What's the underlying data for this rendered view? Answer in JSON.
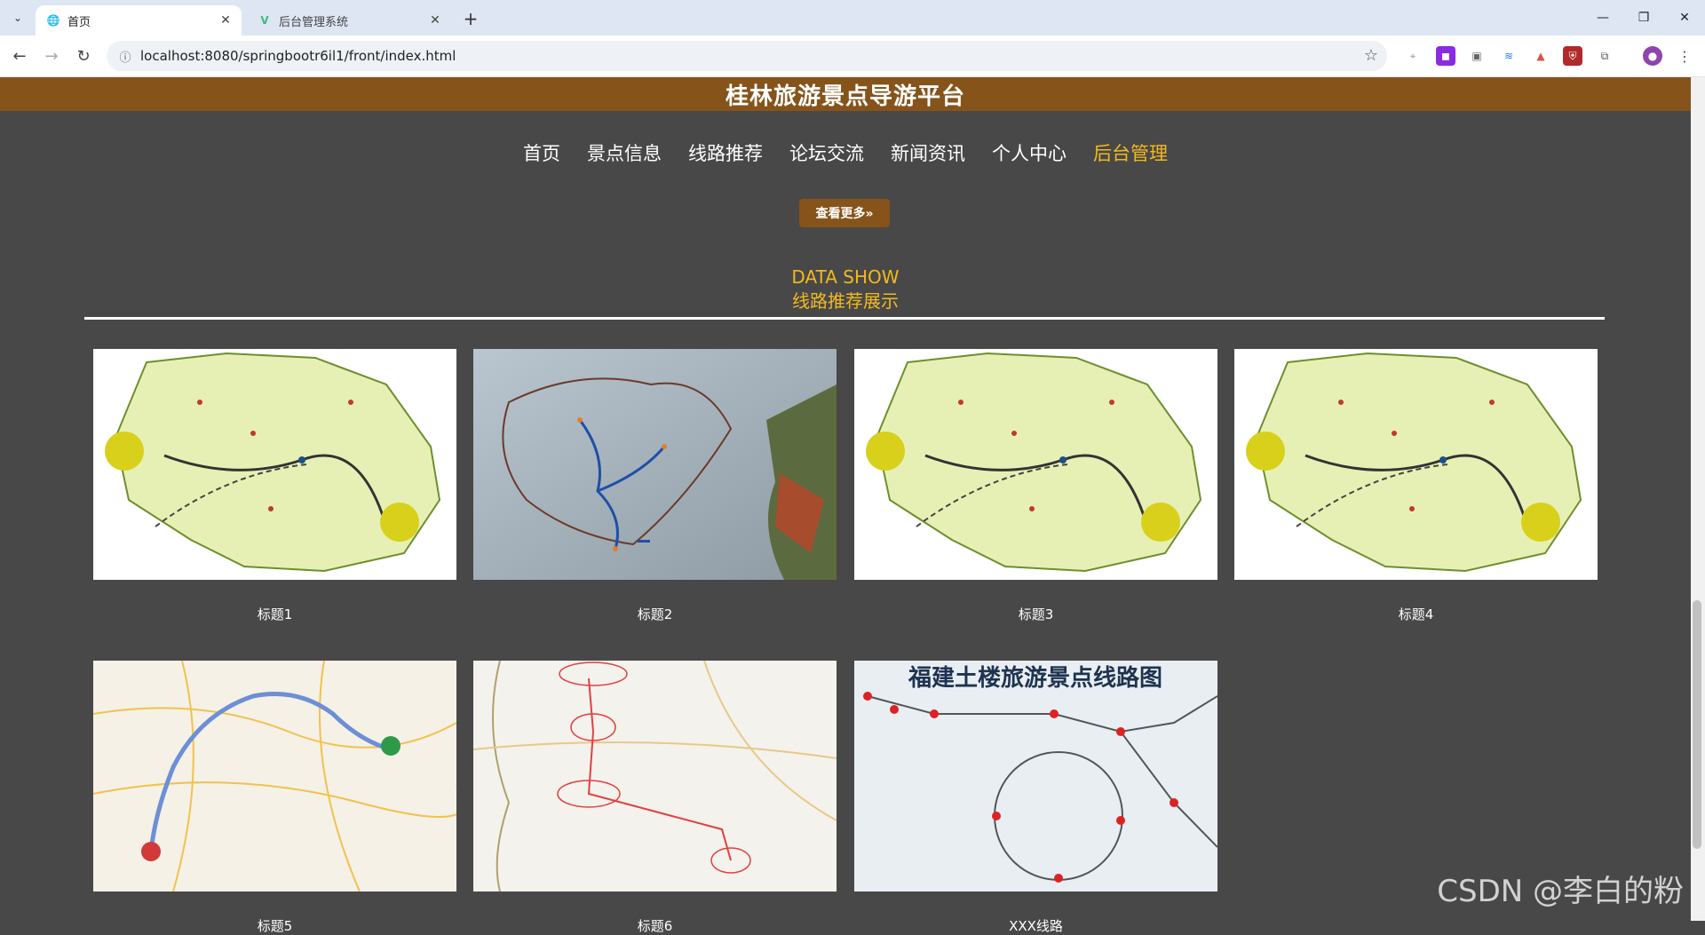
{
  "browser": {
    "tabs": [
      {
        "label": "首页",
        "active": true
      },
      {
        "label": "后台管理系统",
        "active": false
      }
    ],
    "url": "localhost:8080/springbootr6il1/front/index.html",
    "window_controls": {
      "minimize": "—",
      "restore": "❐",
      "close": "✕"
    }
  },
  "site": {
    "title": "桂林旅游景点导游平台",
    "brand_color": "#86531b",
    "accent_color": "#f2b91e"
  },
  "nav": {
    "items": [
      {
        "label": "首页"
      },
      {
        "label": "景点信息"
      },
      {
        "label": "线路推荐"
      },
      {
        "label": "论坛交流"
      },
      {
        "label": "新闻资讯"
      },
      {
        "label": "个人中心"
      },
      {
        "label": "后台管理"
      }
    ],
    "active_index": 6
  },
  "more_button": {
    "label": "查看更多»"
  },
  "section": {
    "title_en": "DATA SHOW",
    "title_cn": "线路推荐展示"
  },
  "cards": [
    {
      "caption": "标题1",
      "image": "yunnan-map"
    },
    {
      "caption": "标题2",
      "image": "scenic-route-photo"
    },
    {
      "caption": "标题3",
      "image": "yunnan-map"
    },
    {
      "caption": "标题4",
      "image": "yunnan-map"
    },
    {
      "caption": "标题5",
      "image": "sichuan-route-map"
    },
    {
      "caption": "标题6",
      "image": "lijiang-route-map"
    },
    {
      "caption": "XXX线路",
      "image": "fujian-tulou-route-map",
      "map_title": "福建土楼旅游景点线路图"
    }
  ],
  "watermark": "CSDN @李白的粉"
}
